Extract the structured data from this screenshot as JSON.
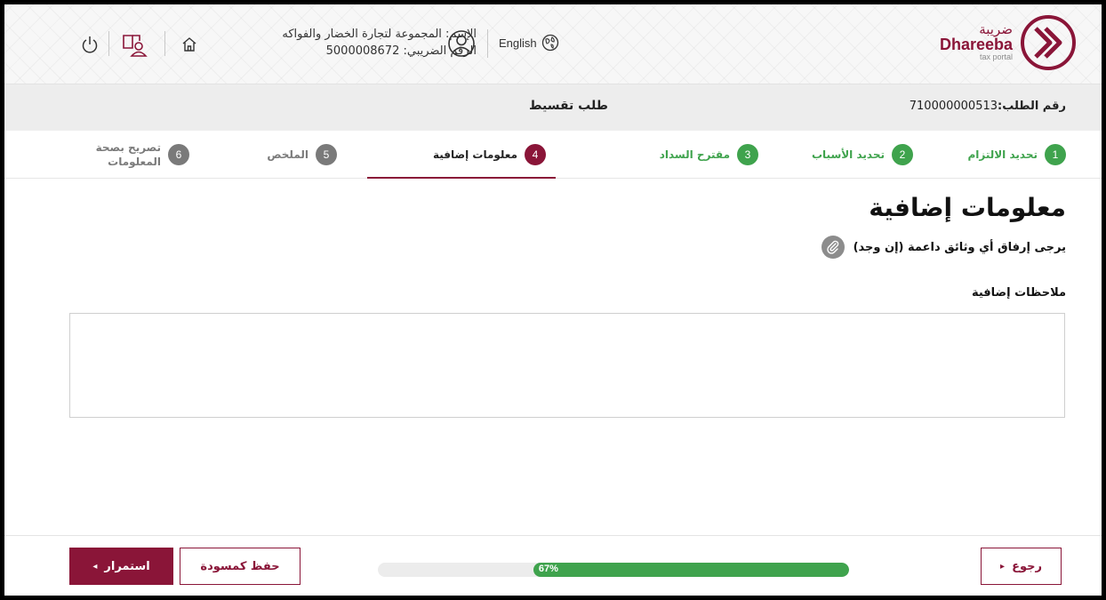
{
  "header": {
    "logo": {
      "arabic": "ضريبة",
      "english": "Dhareeba",
      "subtitle": "tax portal"
    },
    "language_label": "English",
    "user": {
      "name_line": "الإسم: المجموعة لتجارة الخضار والفواكه",
      "tax_line": "الرقم الضريبي: 5000008672"
    },
    "icons": [
      "globe-icon",
      "user-circle-icon",
      "home-icon",
      "contacts-icon",
      "power-icon"
    ]
  },
  "titlebar": {
    "request_label": "رقم الطلب:",
    "request_number": "710000000513",
    "title": "طلب تقسيط"
  },
  "steps": [
    {
      "number": "1",
      "label": "تحديد الالتزام",
      "state": "done"
    },
    {
      "number": "2",
      "label": "تحديد الأسباب",
      "state": "done"
    },
    {
      "number": "3",
      "label": "مقترح السداد",
      "state": "done"
    },
    {
      "number": "4",
      "label": "معلومات إضافية",
      "state": "active"
    },
    {
      "number": "5",
      "label": "الملخص",
      "state": "pending"
    },
    {
      "number": "6",
      "label": "تصريح بصحة المعلومات",
      "state": "pending"
    }
  ],
  "content": {
    "heading": "معلومات إضافية",
    "attach_text": "يرجى إرفاق أي وثائق داعمة (إن وجد)",
    "notes_label": "ملاحظات إضافية",
    "notes_value": ""
  },
  "footer": {
    "back_label": "رجوع",
    "save_draft_label": "حفظ كمسودة",
    "continue_label": "استمرار",
    "progress_text": "67%",
    "progress_value": 0.67
  },
  "colors": {
    "brand": "#8a1538",
    "success": "#3fa34d",
    "pending": "#7a7a7a"
  }
}
